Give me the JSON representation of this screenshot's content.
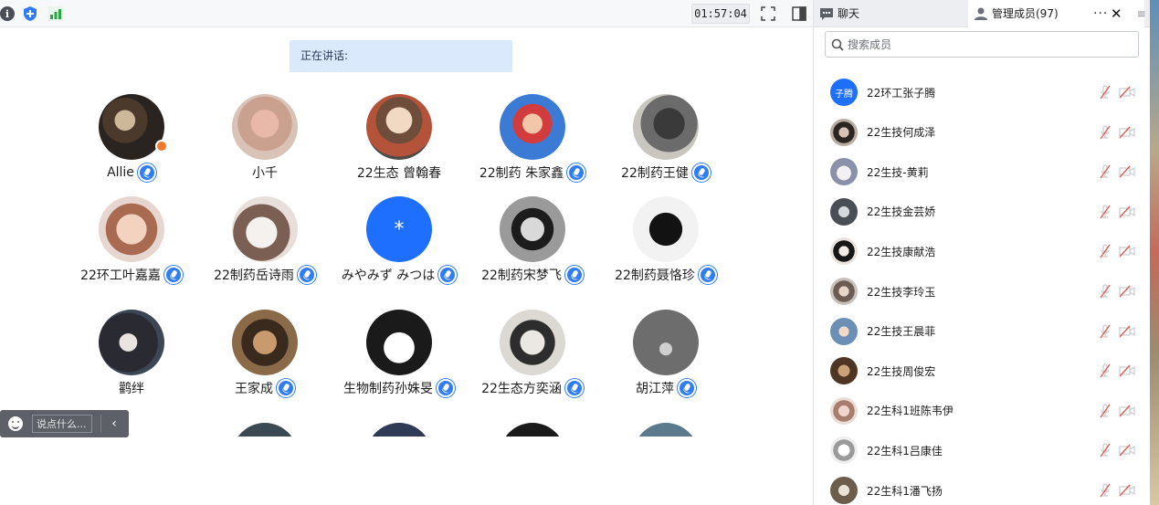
{
  "toolbar": {
    "timer": "01:57:04",
    "icons": [
      "info-icon",
      "shield-icon",
      "signal-icon",
      "fullscreen-icon",
      "layout-icon"
    ]
  },
  "speaking": {
    "label": "正在讲话:"
  },
  "grid": {
    "participants": [
      {
        "name": "Allie",
        "avatar": "photo-dog",
        "mic": true,
        "host": true
      },
      {
        "name": "小千",
        "avatar": "photo-girl",
        "mic": false
      },
      {
        "name": "22生态 曾翰春",
        "avatar": "photo-anime",
        "mic": false
      },
      {
        "name": "22制药 朱家鑫",
        "avatar": "photo-cartoon",
        "mic": true
      },
      {
        "name": "22制药王健",
        "avatar": "photo-man",
        "mic": true
      },
      {
        "name": "22环工叶嘉嘉",
        "avatar": "photo-child",
        "mic": true
      },
      {
        "name": "22制药岳诗雨",
        "avatar": "photo-cat",
        "mic": true
      },
      {
        "name": "みやみず みつは",
        "avatar": "text",
        "avatar_text": "*",
        "mic": true
      },
      {
        "name": "22制药宋梦飞",
        "avatar": "photo-manga",
        "mic": true
      },
      {
        "name": "22制药聂恪珍",
        "avatar": "photo-sketch",
        "mic": true
      },
      {
        "name": "鹳绊",
        "avatar": "photo-dark",
        "mic": false
      },
      {
        "name": "王家成",
        "avatar": "photo-boy",
        "mic": true
      },
      {
        "name": "生物制药孙姝旻",
        "avatar": "photo-kuromi",
        "mic": true
      },
      {
        "name": "22生态方奕涵",
        "avatar": "photo-cap",
        "mic": true
      },
      {
        "name": "胡江萍",
        "avatar": "photo-vase",
        "mic": true
      }
    ]
  },
  "chatbar": {
    "placeholder": "说点什么..."
  },
  "panel": {
    "tab_chat": "聊天",
    "tab_members": "管理成员(97)",
    "more": "···",
    "close": "✕",
    "menu": "≡",
    "search_placeholder": "搜索成员",
    "members": [
      {
        "name": "22环工张子腾",
        "avatar": "text",
        "avatar_text": "子腾"
      },
      {
        "name": "22生技何成泽",
        "avatar": "photo"
      },
      {
        "name": "22生技-黄莉",
        "avatar": "photo"
      },
      {
        "name": "22生技金芸娇",
        "avatar": "photo"
      },
      {
        "name": "22生技康献浩",
        "avatar": "photo"
      },
      {
        "name": "22生技李玲玉",
        "avatar": "photo"
      },
      {
        "name": "22生技王晨菲",
        "avatar": "photo"
      },
      {
        "name": "22生技周俊宏",
        "avatar": "photo"
      },
      {
        "name": "22生科1班陈韦伊",
        "avatar": "photo"
      },
      {
        "name": "22生科1吕康佳",
        "avatar": "photo"
      },
      {
        "name": "22生科1潘飞扬",
        "avatar": "photo"
      }
    ]
  }
}
